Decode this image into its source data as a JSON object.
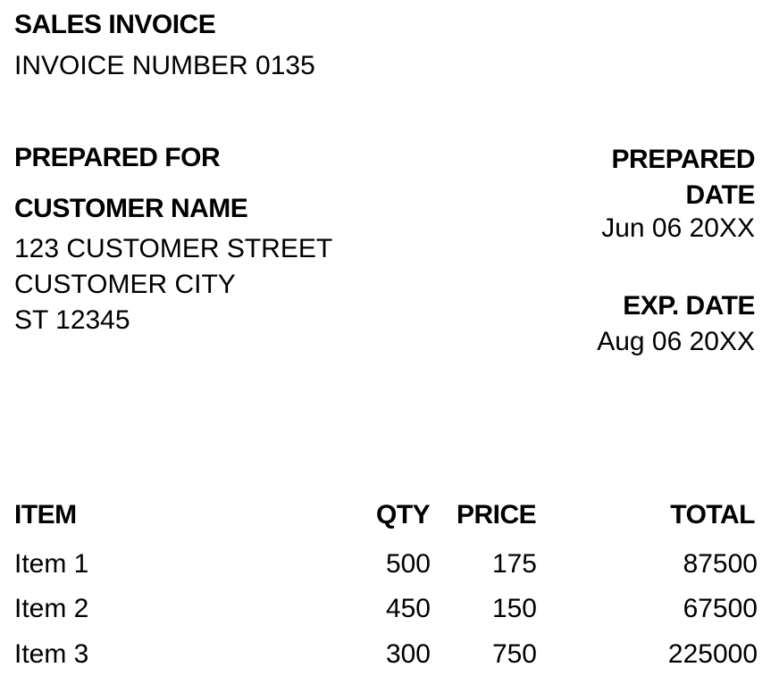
{
  "header": {
    "title": "SALES INVOICE",
    "invoice_number": "INVOICE NUMBER 0135"
  },
  "prepared_for": {
    "heading": "PREPARED FOR",
    "customer_name": "CUSTOMER NAME",
    "street": "123 CUSTOMER STREET",
    "city": "CUSTOMER CITY",
    "state_zip": "ST 12345"
  },
  "dates": {
    "prepared_heading": "PREPARED DATE",
    "prepared_value": "Jun 06 20XX",
    "exp_heading": "EXP. DATE",
    "exp_value": "Aug 06 20XX"
  },
  "table": {
    "headers": {
      "item": "ITEM",
      "qty": "QTY",
      "price": "PRICE",
      "total": "TOTAL"
    },
    "rows": [
      {
        "item": "Item 1",
        "qty": "500",
        "price": "175",
        "total": "87500"
      },
      {
        "item": "Item 2",
        "qty": "450",
        "price": "150",
        "total": "67500"
      },
      {
        "item": "Item 3",
        "qty": "300",
        "price": "750",
        "total": "225000"
      }
    ]
  }
}
